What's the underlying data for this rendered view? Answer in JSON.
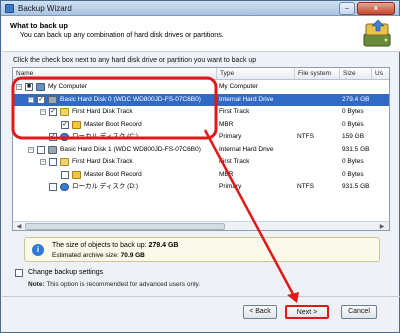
{
  "window": {
    "title": "Backup Wizard",
    "minimize_glyph": "–",
    "close_glyph": "x"
  },
  "header": {
    "title": "What to back up",
    "subtitle": "You can back up any combination of hard disk drives or partitions."
  },
  "instruction": "Click the check box next to any hard disk drive or partition you want to back up",
  "columns": [
    "Name",
    "Type",
    "File system",
    "Size",
    "Us"
  ],
  "tree_rows": [
    {
      "name": "My Computer",
      "type": "My Computer",
      "fs": "",
      "size": "",
      "checked": "■",
      "expander": "−",
      "icon": "computer-icon"
    },
    {
      "name": "Basic Hard Disk 0 (WDC WD800JD-FS-07C6B0)",
      "type": "Internal Hard Drive",
      "fs": "",
      "size": "279.4 GB",
      "checked": "✓",
      "expander": "−",
      "icon": "hard-disk-icon",
      "selected": true
    },
    {
      "name": "First Hard Disk Track",
      "type": "First Track",
      "fs": "",
      "size": "0 Bytes",
      "checked": "✓",
      "expander": "−",
      "icon": "track-icon"
    },
    {
      "name": "Master Boot Record",
      "type": "MBR",
      "fs": "",
      "size": "0 Bytes",
      "checked": "✓",
      "expander": "",
      "icon": "mbr-icon"
    },
    {
      "name": "ローカル ディスク (C:)",
      "type": "Primary",
      "fs": "NTFS",
      "size": "159 GB",
      "checked": "✓",
      "expander": "",
      "icon": "volume-icon"
    },
    {
      "name": "Basic Hard Disk 1 (WDC WD800JD-FS-07C6B0)",
      "type": "Internal Hard Drive",
      "fs": "",
      "size": "931.5 GB",
      "checked": "",
      "expander": "−",
      "icon": "hard-disk-icon"
    },
    {
      "name": "First Hard Disk Track",
      "type": "First Track",
      "fs": "",
      "size": "0 Bytes",
      "checked": "",
      "expander": "−",
      "icon": "track-icon"
    },
    {
      "name": "Master Boot Record",
      "type": "MBR",
      "fs": "",
      "size": "0 Bytes",
      "checked": "",
      "expander": "",
      "icon": "mbr-icon"
    },
    {
      "name": "ローカル ディスク (D:)",
      "type": "Primary",
      "fs": "NTFS",
      "size": "931.5 GB",
      "checked": "",
      "expander": "",
      "icon": "volume-icon"
    }
  ],
  "info": {
    "line1_label": "The size of objects to back up:",
    "line1_value": "279.4 GB",
    "line2_label": "Estimated archive size:",
    "line2_value": "70.9 GB"
  },
  "options": {
    "change_settings_label": "Change backup settings",
    "note_label": "Note:",
    "note_text": "This option is recommended for advanced users only."
  },
  "buttons": {
    "back": "< Back",
    "next": "Next >",
    "cancel": "Cancel"
  },
  "colors": {
    "annotation": "#e01818",
    "selection": "#316ac5"
  }
}
